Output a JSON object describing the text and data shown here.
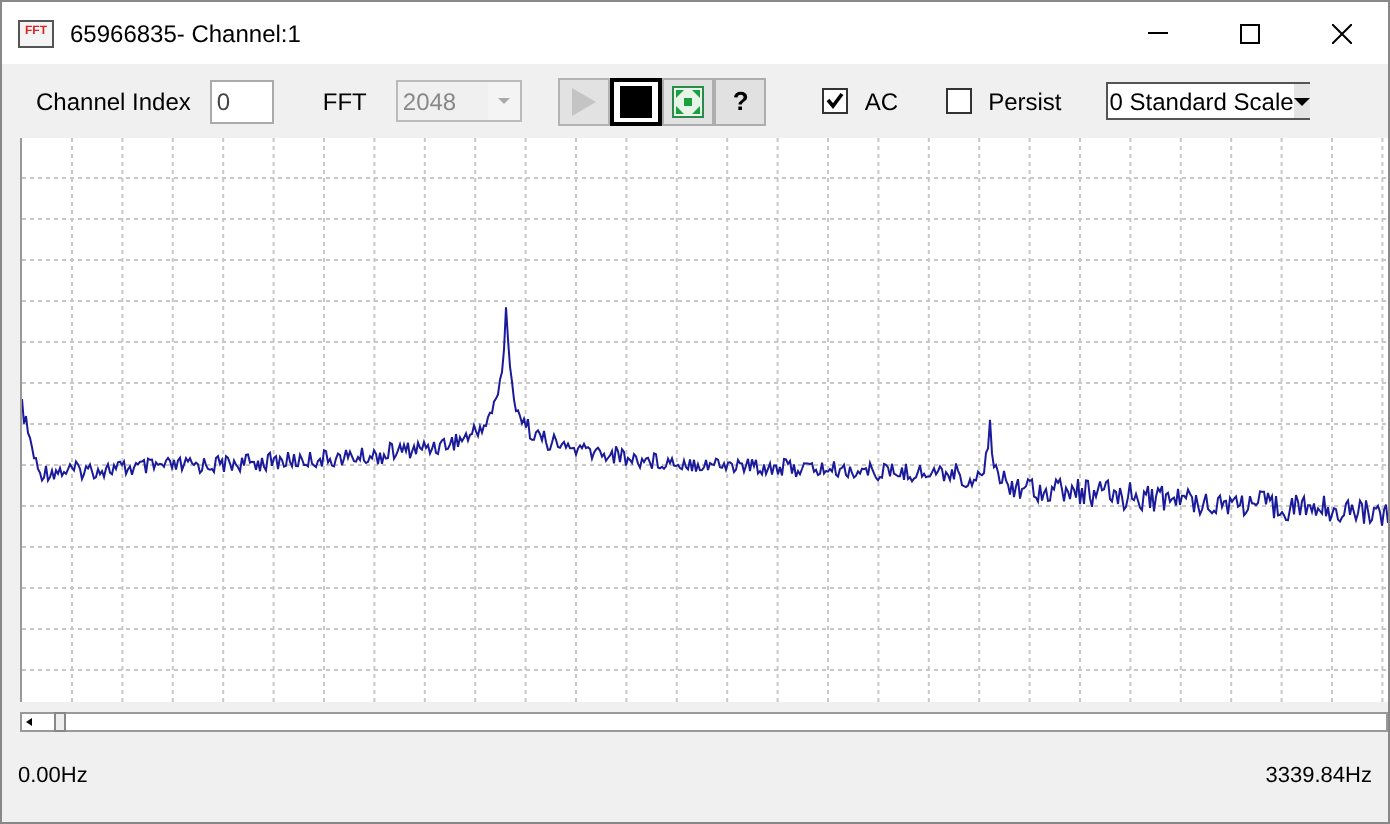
{
  "window": {
    "title": "65966835- Channel:1",
    "app_icon_text": "FFT"
  },
  "toolbar": {
    "channel_index": {
      "label": "Channel Index",
      "value": "0"
    },
    "fft": {
      "label": "FFT",
      "value": "2048",
      "disabled": true
    },
    "buttons": [
      {
        "kind": "play",
        "disabled": true,
        "selected": false
      },
      {
        "kind": "stop",
        "disabled": false,
        "selected": true
      },
      {
        "kind": "fit",
        "disabled": false,
        "selected": false
      },
      {
        "kind": "help",
        "label": "?",
        "disabled": false,
        "selected": false
      }
    ],
    "checkboxes": [
      {
        "label": "AC",
        "checked": true
      },
      {
        "label": "Persist",
        "checked": false
      }
    ],
    "scale": {
      "value": "0 Standard Scale"
    }
  },
  "footer": {
    "start": "0.00Hz",
    "end": "3339.84Hz"
  }
}
